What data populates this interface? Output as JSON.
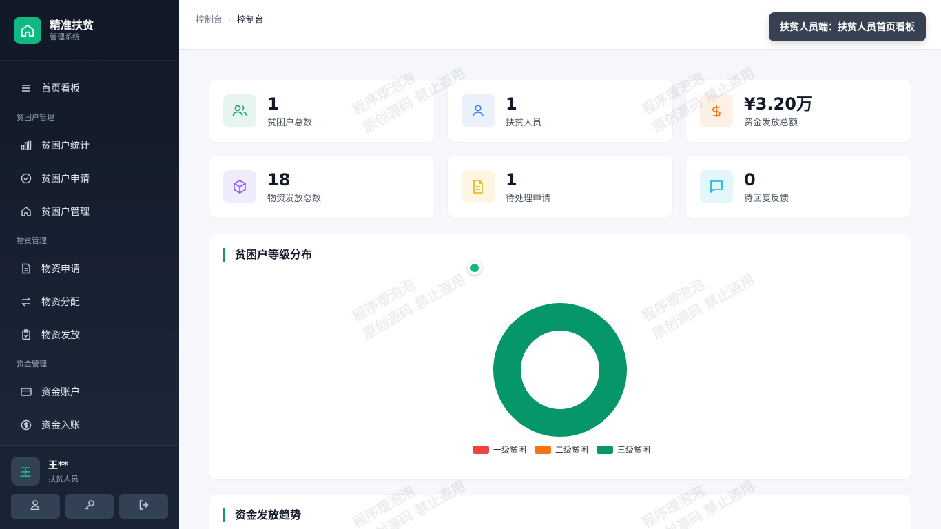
{
  "brand": {
    "title": "精准扶贫",
    "subtitle": "管理系统"
  },
  "nav": {
    "home": "首页看板",
    "group1": "贫困户管理",
    "stats": "贫困户统计",
    "apply": "贫困户申请",
    "manage": "贫困户管理",
    "group2": "物资管理",
    "mat_apply": "物资申请",
    "mat_alloc": "物资分配",
    "mat_dist": "物资发放",
    "group3": "资金管理",
    "fund_acct": "资金账户",
    "fund_in": "资金入账"
  },
  "user": {
    "avatar": "王",
    "name": "王**",
    "role": "扶贫人员"
  },
  "header": {
    "crumb1": "控制台",
    "crumb2": "控制台",
    "role_pill": "扶贫人员端：扶贫人员首页看板"
  },
  "stats": [
    {
      "value": "1",
      "label": "贫困户总数"
    },
    {
      "value": "1",
      "label": "扶贫人员"
    },
    {
      "value": "¥3.20万",
      "label": "资金发放总额"
    },
    {
      "value": "18",
      "label": "物资发放总数"
    },
    {
      "value": "1",
      "label": "待处理申请"
    },
    {
      "value": "0",
      "label": "待回复反馈"
    }
  ],
  "chart_title": "贫困户等级分布",
  "trend_title": "资金发放趋势",
  "watermark": "程序瑷泡泡\n原创源码 禁止盗用",
  "chart_data": {
    "type": "pie",
    "categories": [
      "一级贫困",
      "二级贫困",
      "三级贫困"
    ],
    "values": [
      0,
      0,
      1
    ],
    "colors": [
      "#ef4444",
      "#f97316",
      "#059669"
    ]
  }
}
